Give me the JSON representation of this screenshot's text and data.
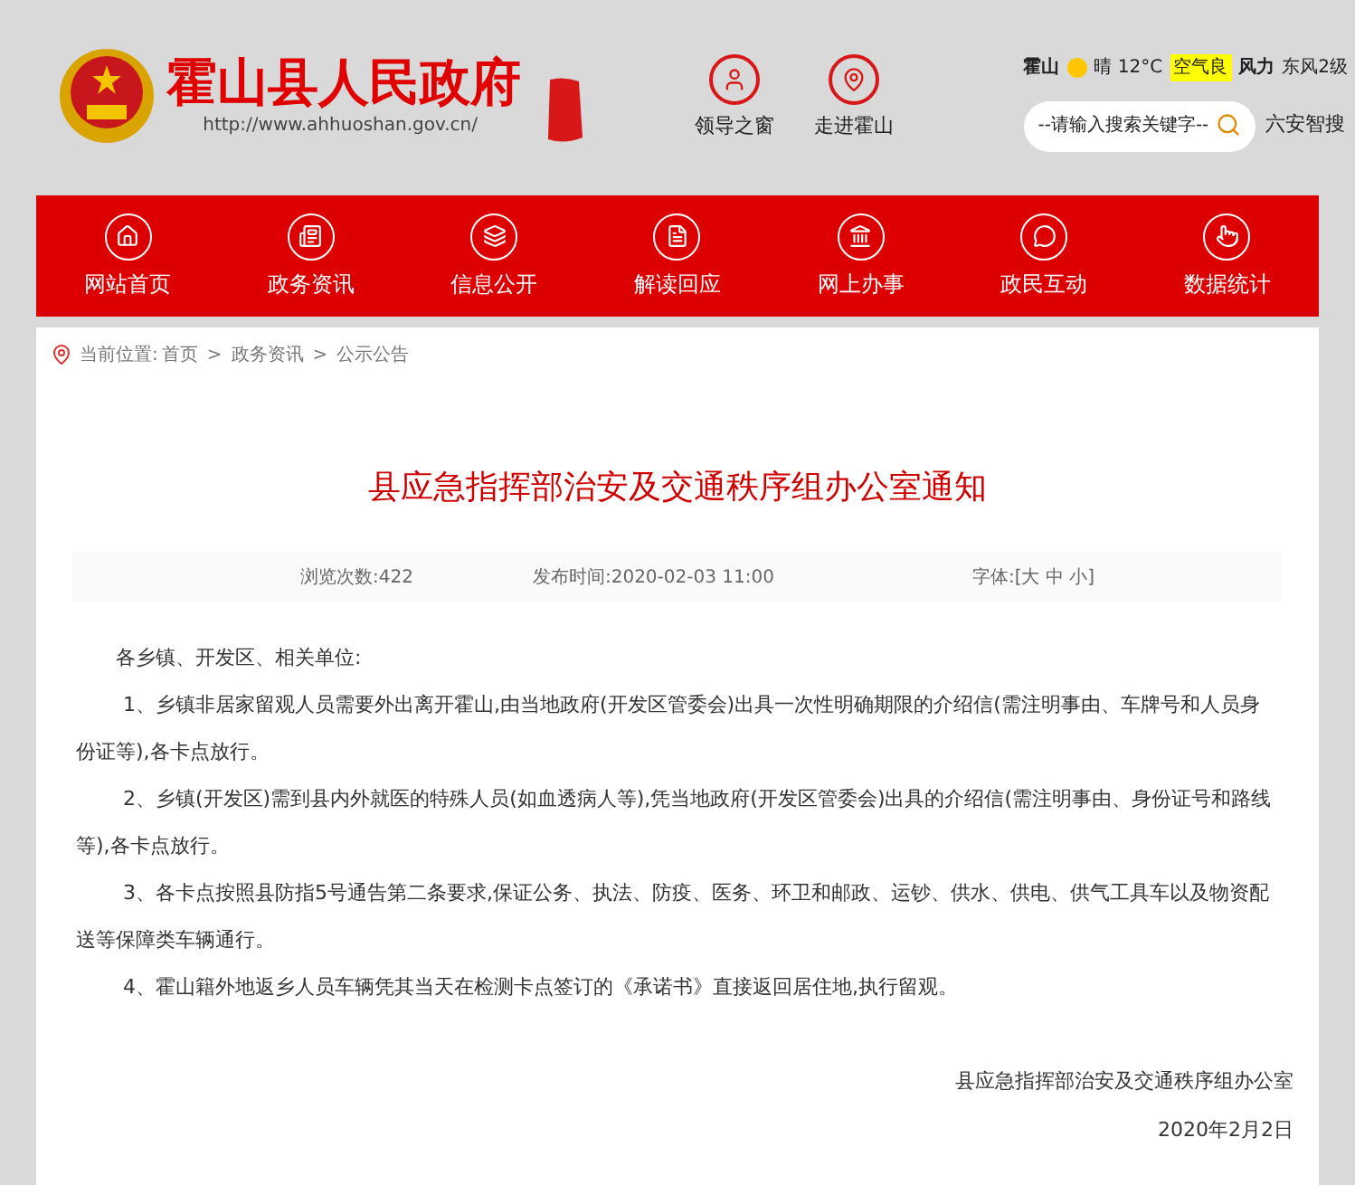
{
  "header": {
    "site_name": "霍山县人民政府",
    "url": "http://www.ahhuoshan.gov.cn/",
    "quick_links": [
      {
        "label": "领导之窗"
      },
      {
        "label": "走进霍山"
      }
    ],
    "weather": {
      "place": "霍山",
      "condition": "晴 12°C",
      "air_quality": "空气良",
      "wind_label": "风力",
      "wind": "东风2级"
    },
    "search": {
      "placeholder": "--请输入搜索关键字--"
    },
    "search_link": "六安智搜"
  },
  "nav": [
    {
      "label": "网站首页"
    },
    {
      "label": "政务资讯"
    },
    {
      "label": "信息公开"
    },
    {
      "label": "解读回应"
    },
    {
      "label": "网上办事"
    },
    {
      "label": "政民互动"
    },
    {
      "label": "数据统计"
    }
  ],
  "breadcrumb": {
    "prefix": "当前位置:",
    "separator": ">",
    "items": [
      "首页",
      "政务资讯",
      "公示公告"
    ]
  },
  "article": {
    "title": "县应急指挥部治安及交通秩序组办公室通知",
    "meta": {
      "views": "浏览次数:422",
      "published": "发布时间:2020-02-03 11:00",
      "font_size": "字体:[大 中 小]"
    },
    "greeting": "各乡镇、开发区、相关单位:",
    "paragraphs": [
      "1、乡镇非居家留观人员需要外出离开霍山,由当地政府(开发区管委会)出具一次性明确期限的介绍信(需注明事由、车牌号和人员身份证等),各卡点放行。",
      "2、乡镇(开发区)需到县内外就医的特殊人员(如血透病人等),凭当地政府(开发区管委会)出具的介绍信(需注明事由、身份证号和路线等),各卡点放行。",
      "3、各卡点按照县防指5号通告第二条要求,保证公务、执法、防疫、医务、环卫和邮政、运钞、供水、供电、供气工具车以及物资配送等保障类车辆通行。",
      "4、霍山籍外地返乡人员车辆凭其当天在检测卡点签订的《承诺书》直接返回居住地,执行留观。"
    ],
    "signature": "县应急指挥部治安及交通秩序组办公室",
    "date": "2020年2月2日"
  }
}
